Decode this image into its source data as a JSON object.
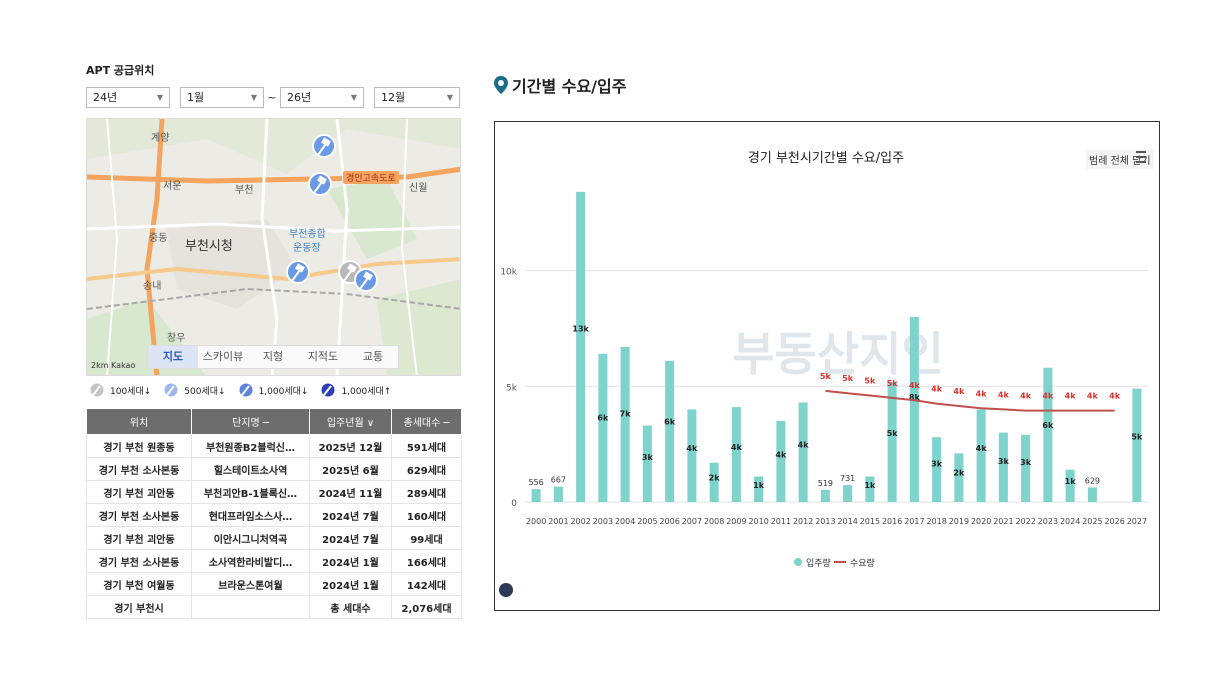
{
  "left": {
    "section_title": "APT 공급위치",
    "filters": {
      "start_year": "24년",
      "start_month": "1월",
      "tilde": "~",
      "end_year": "26년",
      "end_month": "12월"
    },
    "map_labels": {
      "gyeyang": "계양",
      "seoun": "서운",
      "bucheon": "부천",
      "jungdong": "중동",
      "songnae": "송내",
      "bucheon_city_hall": "부천시청",
      "sports_complex_1": "부천종합",
      "sports_complex_2": "운동장",
      "sinwol": "신월",
      "expressway": "경인고속도로",
      "samgok": "창우"
    },
    "map_tabs": [
      "지도",
      "스카이뷰",
      "지형",
      "지적도",
      "교통"
    ],
    "scale": "2km  Kakao",
    "legend": [
      "100세대↓",
      "500세대↓",
      "1,000세대↓",
      "1,000세대↑"
    ],
    "table": {
      "headers": [
        "위치",
        "단지명 ─",
        "입주년월 ∨",
        "총세대수 ─"
      ],
      "rows": [
        [
          "경기 부천 원종동",
          "부천원종B2블럭신…",
          "2025년 12월",
          "591세대"
        ],
        [
          "경기 부천 소사본동",
          "힐스테이트소사역",
          "2025년 6월",
          "629세대"
        ],
        [
          "경기 부천 괴안동",
          "부천괴안B-1블록신…",
          "2024년 11월",
          "289세대"
        ],
        [
          "경기 부천 소사본동",
          "현대프라임소스사…",
          "2024년 7월",
          "160세대"
        ],
        [
          "경기 부천 괴안동",
          "이안시그니처역곡",
          "2024년 7월",
          "99세대"
        ],
        [
          "경기 부천 소사본동",
          "소사역한라비발디…",
          "2024년 1월",
          "166세대"
        ],
        [
          "경기 부천 여월동",
          "브라운스톤여월",
          "2024년 1월",
          "142세대"
        ],
        [
          "경기 부천시",
          "",
          "총 세대수",
          "2,076세대"
        ]
      ]
    }
  },
  "right": {
    "panel_title": "기간별 수요/입주",
    "menu_label": "범례 전체 닫기",
    "watermark": "부동산지인"
  },
  "colors": {
    "bar": "#7ed3cd",
    "line": "#c0504d",
    "label_red": "#e0302e",
    "header_gray": "#6d6d6d"
  },
  "chart_data": {
    "type": "bar",
    "title": "경기 부천시기간별 수요/입주",
    "categories": [
      "2000",
      "2001",
      "2002",
      "2003",
      "2004",
      "2005",
      "2006",
      "2007",
      "2008",
      "2009",
      "2010",
      "2011",
      "2012",
      "2013",
      "2014",
      "2015",
      "2016",
      "2017",
      "2018",
      "2019",
      "2020",
      "2021",
      "2022",
      "2023",
      "2024",
      "2025",
      "2026",
      "2027"
    ],
    "yticks": [
      "0",
      "5k",
      "10k"
    ],
    "ylim": [
      0,
      14000
    ],
    "series": [
      {
        "name": "입주량",
        "type": "bar",
        "values": [
          556,
          667,
          13400,
          6400,
          6700,
          3300,
          6100,
          4000,
          1700,
          4100,
          1100,
          3500,
          4300,
          519,
          731,
          1100,
          5200,
          8000,
          2800,
          2100,
          4000,
          3000,
          2900,
          5800,
          1400,
          629,
          0,
          4900
        ],
        "labels": [
          "556",
          "667",
          "13k",
          "6k",
          "7k",
          "3k",
          "6k",
          "4k",
          "2k",
          "4k",
          "1k",
          "4k",
          "4k",
          "519",
          "731",
          "1k",
          "5k",
          "8k",
          "3k",
          "2k",
          "4k",
          "3k",
          "3k",
          "6k",
          "1k",
          "629",
          "",
          "5k"
        ]
      },
      {
        "name": "수요량",
        "type": "line",
        "values": [
          null,
          null,
          null,
          null,
          null,
          null,
          null,
          null,
          null,
          null,
          null,
          null,
          null,
          4800,
          4700,
          4600,
          4500,
          4400,
          4250,
          4150,
          4050,
          4000,
          3950,
          3950,
          3950,
          3950,
          3950,
          null
        ],
        "labels": [
          "",
          "",
          "",
          "",
          "",
          "",
          "",
          "",
          "",
          "",
          "",
          "",
          "",
          "5k",
          "5k",
          "5k",
          "5k",
          "4k",
          "4k",
          "4k",
          "4k",
          "4k",
          "4k",
          "4k",
          "4k",
          "4k",
          "4k",
          ""
        ]
      }
    ]
  }
}
